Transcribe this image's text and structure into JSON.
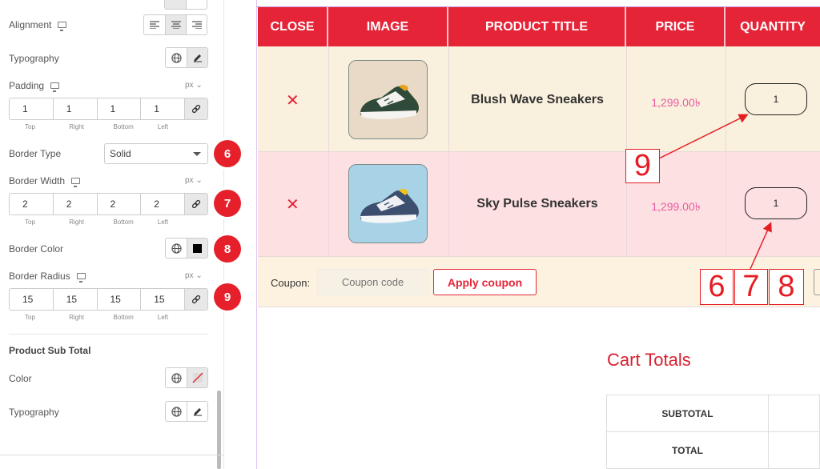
{
  "panel": {
    "alignment_label": "Alignment",
    "typography_label": "Typography",
    "padding": {
      "label": "Padding",
      "unit": "px",
      "values": [
        "1",
        "1",
        "1",
        "1"
      ]
    },
    "dim_labels": [
      "Top",
      "Right",
      "Bottom",
      "Left"
    ],
    "border_type": {
      "label": "Border Type",
      "value": "Solid"
    },
    "border_width": {
      "label": "Border Width",
      "unit": "px",
      "values": [
        "2",
        "2",
        "2",
        "2"
      ]
    },
    "border_color_label": "Border Color",
    "border_radius": {
      "label": "Border Radius",
      "unit": "px",
      "values": [
        "15",
        "15",
        "15",
        "15"
      ]
    },
    "subtotal_section": "Product Sub Total",
    "color_label": "Color",
    "typography2_label": "Typography",
    "badges": [
      "6",
      "7",
      "8",
      "9"
    ]
  },
  "cart": {
    "headers": [
      "CLOSE",
      "IMAGE",
      "PRODUCT TITLE",
      "PRICE",
      "QUANTITY"
    ],
    "rows": [
      {
        "close": "✕",
        "title": "Blush Wave Sneakers",
        "price": "1,299.00৳",
        "qty": "1"
      },
      {
        "close": "✕",
        "title": "Sky Pulse Sneakers",
        "price": "1,299.00৳",
        "qty": "1"
      }
    ],
    "coupon_label": "Coupon:",
    "coupon_placeholder": "Coupon code",
    "apply_label": "Apply coupon",
    "callouts": [
      "9",
      "6",
      "7",
      "8"
    ]
  },
  "totals": {
    "title": "Cart Totals",
    "rows": [
      "SUBTOTAL",
      "TOTAL"
    ]
  },
  "colors": {
    "header_red": "#e62437",
    "row1_bg": "#f9f0dd",
    "row2_bg": "#fde0e2",
    "coupon_row_bg": "#fcf2df",
    "annotation_red": "#e61c23"
  }
}
